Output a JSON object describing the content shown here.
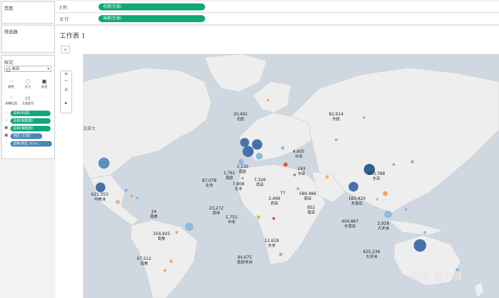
{
  "panels": {
    "pages_title": "页面",
    "filters_title": "筛选器",
    "marks_title": "标记",
    "marks_type": "自动",
    "mark_buttons": [
      {
        "label": "颜色",
        "icon": "color-icon"
      },
      {
        "label": "大小",
        "icon": "size-icon"
      },
      {
        "label": "标签",
        "icon": "label-icon"
      },
      {
        "label": "详细信息",
        "icon": "detail-icon"
      },
      {
        "label": "工具提示",
        "icon": "tooltip-icon"
      }
    ],
    "mark_pills": [
      {
        "label": "总和(利润)",
        "color": "#12a77a",
        "icon": "color-icon"
      },
      {
        "label": "总和(销售额)",
        "color": "#12a77a",
        "icon": "size-icon"
      },
      {
        "label": "总和(销售额)",
        "color": "#12a77a",
        "icon": "label-icon"
      },
      {
        "label": "地区 (订单)",
        "color": "#4a86b8",
        "icon": "label-icon"
      },
      {
        "label": "国家/地区 (Cou..",
        "color": "#4a86b8",
        "icon": "detail-icon"
      }
    ]
  },
  "shelves": {
    "columns_label": "列",
    "columns_pill": "经度(生成)",
    "rows_label": "行",
    "rows_pill": "纬度(生成)"
  },
  "view": {
    "title": "工作表 1",
    "country_label": "加拿大"
  },
  "labels": [
    {
      "value": "30,491",
      "region": "北欧"
    },
    {
      "value": "82,914",
      "region": "东欧"
    },
    {
      "value": "4,605",
      "region": "中亚"
    },
    {
      "value": "100,788",
      "region": "东亚"
    },
    {
      "value": "1,761",
      "region": "南欧"
    },
    {
      "value": "3,130",
      "region": "南欧"
    },
    {
      "value": "7,326",
      "region": "西亚"
    },
    {
      "value": "243",
      "region": "中亚"
    },
    {
      "value": "621,553",
      "region": "中美洲"
    },
    {
      "value": "87,078",
      "region": "北非"
    },
    {
      "value": "7,808",
      "region": "北非"
    },
    {
      "value": "77",
      "region": ""
    },
    {
      "value": "2,466",
      "region": "西亚"
    },
    {
      "value": "589,486",
      "region": "南亚"
    },
    {
      "value": "183,420",
      "region": "东南亚"
    },
    {
      "value": "23,272",
      "region": "西非"
    },
    {
      "value": "852",
      "region": "南亚"
    },
    {
      "value": "24",
      "region": "南美"
    },
    {
      "value": "1,752",
      "region": "中非"
    },
    {
      "value": "404,887",
      "region": "东南亚"
    },
    {
      "value": "2,928",
      "region": "大洋洲"
    },
    {
      "value": "359,925",
      "region": "南美"
    },
    {
      "value": "12,618",
      "region": "东非"
    },
    {
      "value": "925,236",
      "region": "大洋洲"
    },
    {
      "value": "94,675",
      "region": "南部非洲"
    },
    {
      "value": "67,512",
      "region": "南美"
    }
  ],
  "watermark": "知乎 @小贤"
}
